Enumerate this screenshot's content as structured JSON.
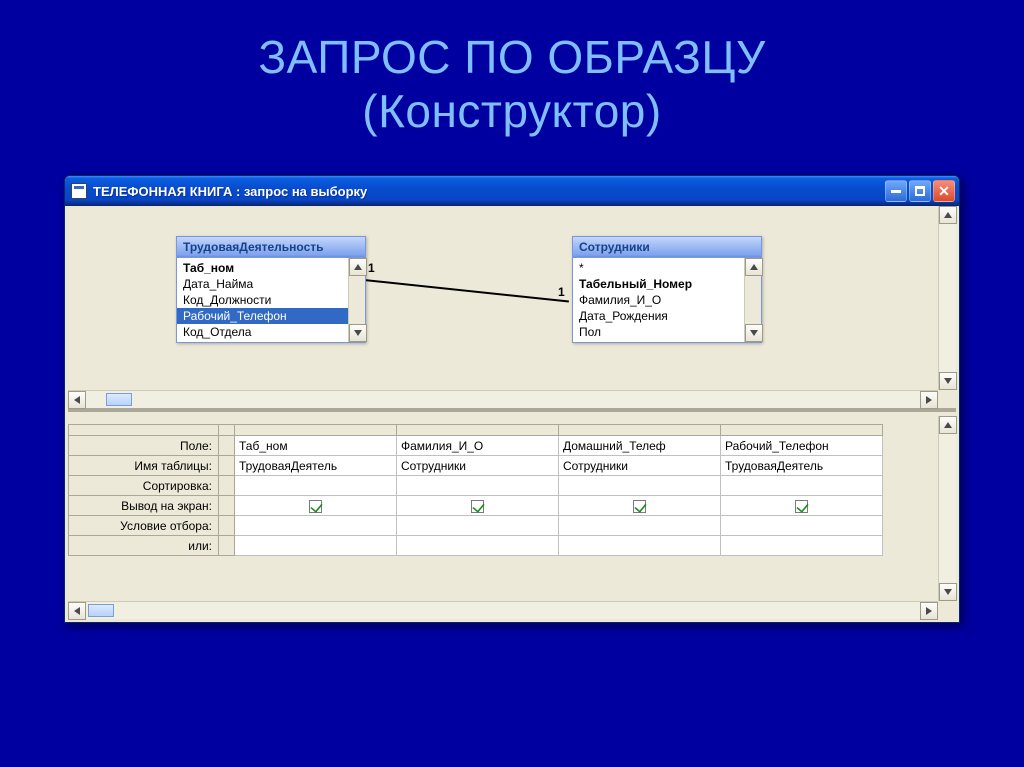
{
  "slide": {
    "title_line1": "ЗАПРОС ПО ОБРАЗЦУ",
    "title_line2": "(Конструктор)"
  },
  "window": {
    "title": "ТЕЛЕФОННАЯ КНИГА : запрос на выборку"
  },
  "tables": {
    "left": {
      "title": "ТрудоваяДеятельность",
      "fields": [
        "Таб_ном",
        "Дата_Найма",
        "Код_Должности",
        "Рабочий_Телефон",
        "Код_Отдела"
      ],
      "bold_index": 0,
      "selected_index": 3
    },
    "right": {
      "title": "Сотрудники",
      "fields": [
        "*",
        "Табельный_Номер",
        "Фамилия_И_О",
        "Дата_Рождения",
        "Пол"
      ],
      "bold_index": 1,
      "selected_index": -1
    }
  },
  "relationship": {
    "left_label": "1",
    "right_label": "1"
  },
  "grid": {
    "row_labels": [
      "Поле:",
      "Имя таблицы:",
      "Сортировка:",
      "Вывод на экран:",
      "Условие отбора:",
      "или:"
    ],
    "columns": [
      {
        "field": "Таб_ном",
        "table": "ТрудоваяДеятель",
        "sort": "",
        "show": true,
        "criteria": "",
        "or": ""
      },
      {
        "field": "Фамилия_И_О",
        "table": "Сотрудники",
        "sort": "",
        "show": true,
        "criteria": "",
        "or": ""
      },
      {
        "field": "Домашний_Телеф",
        "table": "Сотрудники",
        "sort": "",
        "show": true,
        "criteria": "",
        "or": ""
      },
      {
        "field": "Рабочий_Телефон",
        "table": "ТрудоваяДеятель",
        "sort": "",
        "show": true,
        "criteria": "",
        "or": ""
      }
    ]
  }
}
